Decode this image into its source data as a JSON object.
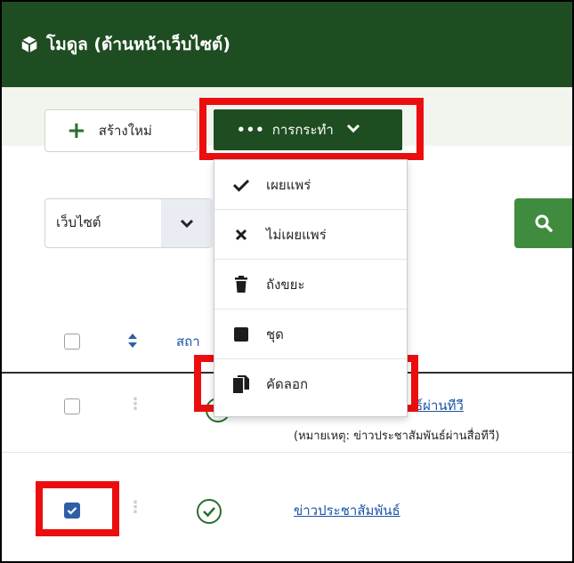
{
  "header": {
    "title": "โมดูล (ด้านหน้าเว็บไซต์)",
    "icon": "cube-icon"
  },
  "toolbar": {
    "new_label": "สร้างใหม่",
    "actions_label": "การกระทำ"
  },
  "actions_menu": {
    "items": [
      {
        "label": "เผยแพร่",
        "icon": "check-icon"
      },
      {
        "label": "ไม่เผยแพร่",
        "icon": "times-icon"
      },
      {
        "label": "ถังขยะ",
        "icon": "trash-icon"
      },
      {
        "label": "ชุด",
        "icon": "square-icon"
      },
      {
        "label": "คัดลอก",
        "icon": "copy-icon"
      }
    ]
  },
  "filters": {
    "site_select_value": "เว็บไซต์"
  },
  "table": {
    "header": {
      "status_label_partial": "สถา"
    },
    "rows": [
      {
        "title_partial": "ธ์ผ่านทีวี",
        "note": "(หมายเหตุ: ข่าวประชาสัมพันธ์ผ่านสื่อทีวี)",
        "checked": false,
        "status": "published"
      },
      {
        "title": "ข่าวประชาสัมพันธ์",
        "checked": true,
        "status": "published"
      }
    ]
  },
  "colors": {
    "header_bg": "#1f4d22",
    "highlight": "#ec0e0e",
    "search_btn": "#3f8c3f",
    "link": "#1a55a8",
    "checkbox_checked": "#2e5fa6"
  }
}
